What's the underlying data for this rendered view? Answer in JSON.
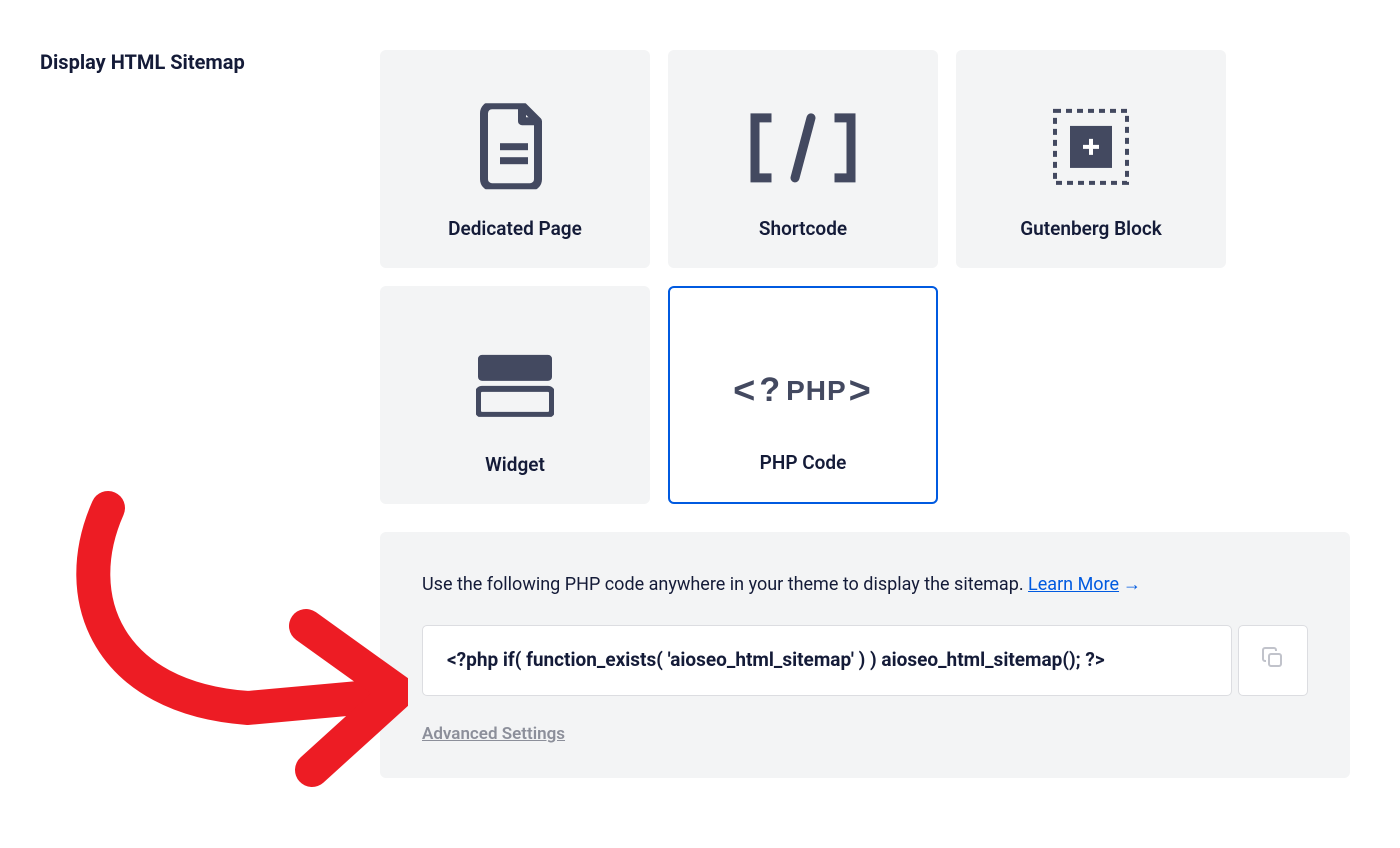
{
  "section_title": "Display HTML Sitemap",
  "cards": [
    {
      "id": "dedicated-page",
      "label": "Dedicated Page"
    },
    {
      "id": "shortcode",
      "label": "Shortcode"
    },
    {
      "id": "gutenberg",
      "label": "Gutenberg Block"
    },
    {
      "id": "widget",
      "label": "Widget"
    },
    {
      "id": "php-code",
      "label": "PHP Code"
    }
  ],
  "panel": {
    "description": "Use the following PHP code anywhere in your theme to display the sitemap. ",
    "learn_more": "Learn More",
    "code": "<?php if( function_exists( 'aioseo_html_sitemap' ) ) aioseo_html_sitemap(); ?>",
    "advanced": "Advanced Settings"
  },
  "php_glyph": "PHP"
}
